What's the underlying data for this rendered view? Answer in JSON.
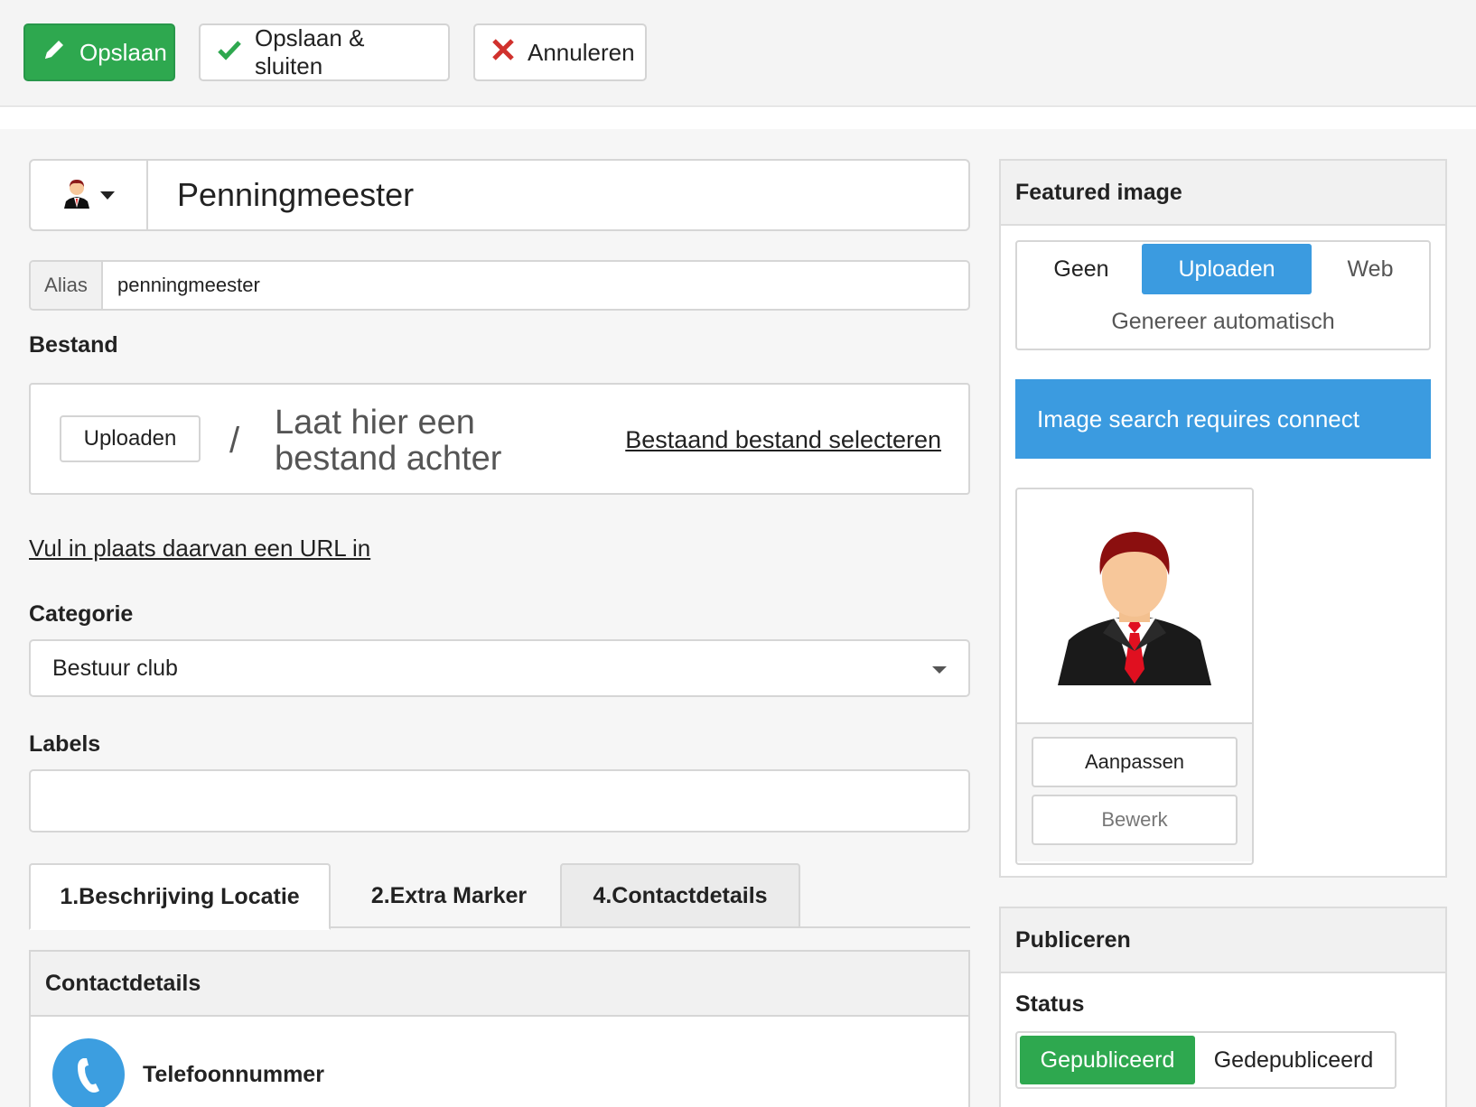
{
  "toolbar": {
    "save_label": "Opslaan",
    "save_close_label": "Opslaan & sluiten",
    "cancel_label": "Annuleren"
  },
  "form": {
    "title_value": "Penningmeester",
    "alias_label": "Alias",
    "alias_value": "penningmeester",
    "file_label": "Bestand",
    "upload_button": "Uploaden",
    "slash": "/",
    "drop_text": "Laat hier een bestand achter",
    "existing_file_link": "Bestaand bestand selecteren",
    "url_link": "Vul in plaats daarvan een URL in",
    "category_label": "Categorie",
    "category_value": "Bestuur club",
    "labels_label": "Labels",
    "labels_value": ""
  },
  "tabs": [
    {
      "label": "1.Beschrijving Locatie",
      "active": true
    },
    {
      "label": "2.Extra Marker",
      "active": false
    },
    {
      "label": "4.Contactdetails",
      "active": false
    }
  ],
  "contact": {
    "heading": "Contactdetails",
    "phone_label": "Telefoonnummer"
  },
  "featured_image": {
    "heading": "Featured image",
    "options": [
      "Geen",
      "Uploaden",
      "Web",
      "Genereer automatisch"
    ],
    "selected": "Uploaden",
    "notice": "Image search requires connect",
    "adjust_button": "Aanpassen",
    "edit_button": "Bewerk"
  },
  "publish": {
    "heading": "Publiceren",
    "status_label": "Status",
    "published_label": "Gepubliceerd",
    "unpublished_label": "Gedepubliceerd",
    "selected": "Gepubliceerd"
  },
  "colors": {
    "green": "#2ea84f",
    "blue": "#3b9be0",
    "red": "#d0312d"
  }
}
